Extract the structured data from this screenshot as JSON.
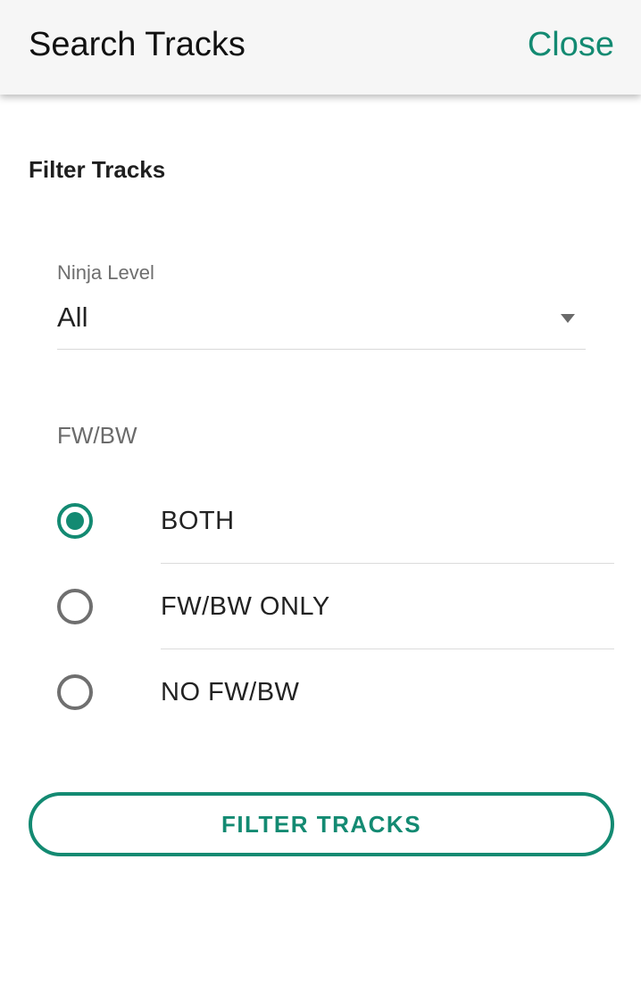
{
  "header": {
    "title": "Search Tracks",
    "close_label": "Close"
  },
  "filter": {
    "section_title": "Filter Tracks",
    "ninja_level": {
      "label": "Ninja Level",
      "value": "All"
    },
    "fwbw": {
      "label": "FW/BW",
      "options": [
        {
          "label": "BOTH",
          "checked": true
        },
        {
          "label": "FW/BW ONLY",
          "checked": false
        },
        {
          "label": "NO FW/BW",
          "checked": false
        }
      ]
    },
    "submit_label": "FILTER TRACKS"
  },
  "colors": {
    "accent": "#138a72",
    "header_bg": "#f6f6f6",
    "text_primary": "#212121",
    "text_secondary": "#6e6e6e",
    "divider": "#dcdcdc"
  }
}
